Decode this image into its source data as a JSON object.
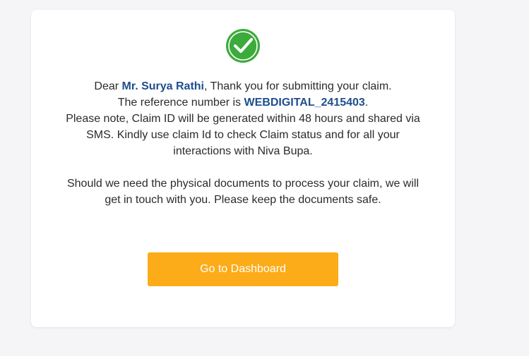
{
  "message": {
    "salutation": "Dear ",
    "customer_name": "Mr. Surya Rathi",
    "thanks": ", Thank you for submitting your claim.",
    "reference_prefix": "The reference number is ",
    "reference_number": "WEBDIGITAL_2415403",
    "reference_suffix": ".",
    "note_line1": "Please note, Claim ID will be generated within 48 hours and shared via",
    "note_line2": "SMS. Kindly use claim Id to check Claim status and for all your",
    "note_line3": "interactions with Niva Bupa.",
    "documents_line1": "Should we need the physical documents to process your claim, we will",
    "documents_line2": "get in touch with you. Please keep the documents safe."
  },
  "actions": {
    "dashboard_label": "Go to Dashboard"
  },
  "colors": {
    "accent_button": "#fcac18",
    "highlight_text": "#1f4e8c",
    "success_icon": "#3cab3b"
  },
  "icons": {
    "success": "check-circle-icon"
  }
}
